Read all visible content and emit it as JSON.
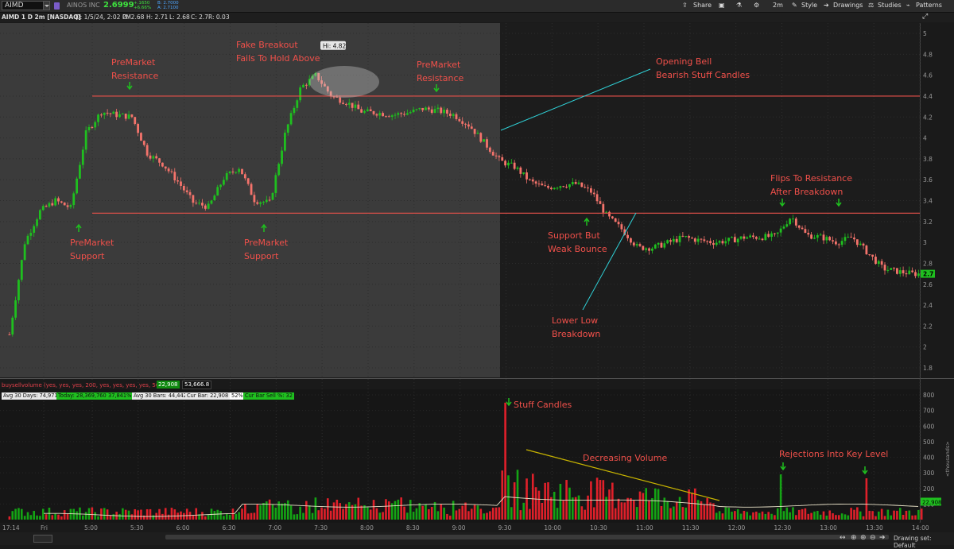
{
  "toolbar": {
    "symbol": "AIMD",
    "company": "AINOS INC",
    "last": "2.6999",
    "change_abs": "+.1650",
    "change_pct": "+6.66%",
    "bid": "B: 2.7000",
    "ask": "A: 2.7100",
    "share": "Share",
    "aggregation": "2m",
    "style": "Style",
    "drawings": "Drawings",
    "studies": "Studies",
    "patterns": "Patterns"
  },
  "infobar": {
    "title": "AIMD 1 D 2m [NASDAQ]",
    "date": "D: 1/5/24, 2:02 PM",
    "open": "O: 2.68",
    "high": "H: 2.71",
    "low": "L: 2.68",
    "close": "C: 2.7",
    "range": "R: 0.03"
  },
  "colors": {
    "up": "#1fbf1f",
    "down": "#f4736b",
    "down_dark": "#e0202a",
    "level": "#e8514a",
    "annot": "#f0504a",
    "bull_text": "#ff5a4f",
    "line": "#2fd0d6",
    "vol_ma": "#e9e2c8",
    "trend": "#c8b400"
  },
  "chart_data": [
    {
      "type": "line",
      "title": "AIMD 1 D 2m [NASDAQ]",
      "price_axis": {
        "ylim": [
          1.72,
          5.08
        ],
        "ticks": [
          "5",
          "4.8",
          "4.6",
          "4.4",
          "4.2",
          "4",
          "3.8",
          "3.6",
          "3.4",
          "3.2",
          "3",
          "2.8",
          "2.6",
          "2.4",
          "2.2",
          "2",
          "1.8"
        ]
      },
      "time_axis": {
        "ticks": [
          "17:14",
          "Fri",
          "5:00",
          "5:30",
          "6:00",
          "6:30",
          "7:00",
          "7:30",
          "8:00",
          "8:30",
          "9:00",
          "9:30",
          "10:00",
          "10:30",
          "11:00",
          "11:30",
          "12:00",
          "12:30",
          "13:00",
          "13:30",
          "14:00"
        ]
      },
      "series": [
        {
          "x": [
            "4:06",
            "4:16",
            "4:26",
            "4:36",
            "4:46",
            "4:56",
            "5:06",
            "5:16",
            "5:26",
            "5:36",
            "5:46",
            "5:56",
            "6:06",
            "6:16",
            "6:26",
            "6:36",
            "6:46",
            "6:56",
            "7:06",
            "7:16",
            "7:26",
            "7:36",
            "7:46",
            "7:56",
            "8:06",
            "8:16",
            "8:26",
            "8:36",
            "8:46",
            "8:56",
            "9:06",
            "9:16",
            "9:26",
            "9:36",
            "9:46",
            "9:56",
            "10:06",
            "10:16",
            "10:26",
            "10:36",
            "10:46",
            "10:56",
            "11:06",
            "11:16",
            "11:26",
            "11:36",
            "11:46",
            "11:56",
            "12:06",
            "12:16",
            "12:26",
            "12:36",
            "12:46",
            "12:56",
            "13:06",
            "13:16",
            "13:26",
            "13:36",
            "13:46",
            "13:56",
            "14:02"
          ],
          "close": [
            2.12,
            3.0,
            3.3,
            3.4,
            3.33,
            4.05,
            4.25,
            4.22,
            4.2,
            3.85,
            3.75,
            3.58,
            3.38,
            3.34,
            3.62,
            3.72,
            3.4,
            3.38,
            4.05,
            4.48,
            4.6,
            4.4,
            4.34,
            4.25,
            4.24,
            4.22,
            4.24,
            4.28,
            4.26,
            4.22,
            4.12,
            3.95,
            3.78,
            3.72,
            3.58,
            3.52,
            3.55,
            3.56,
            3.48,
            3.25,
            3.12,
            2.95,
            2.95,
            3.0,
            3.05,
            3.02,
            3.0,
            3.02,
            3.05,
            3.05,
            3.06,
            3.25,
            3.07,
            3.05,
            3.0,
            3.05,
            2.9,
            2.75,
            2.72,
            2.7,
            2.7
          ]
        }
      ],
      "last_price_label": "2.7",
      "hi_label": "Hi: 4.82",
      "levels": [
        {
          "price": 4.4,
          "name": "resistance"
        },
        {
          "price": 3.28,
          "name": "support"
        }
      ],
      "annotations": {
        "pm_resistance_1": [
          "PreMarket",
          "Resistance"
        ],
        "fake_breakout": [
          "Fake Breakout",
          "Fails To Hold Above"
        ],
        "pm_resistance_2": [
          "PreMarket",
          "Resistance"
        ],
        "opening_bell": [
          "Opening Bell",
          "Bearish Stuff Candles"
        ],
        "pm_support_1": [
          "PreMarket",
          "Support"
        ],
        "pm_support_2": [
          "PreMarket",
          "Support"
        ],
        "weak_bounce": [
          "Support But",
          "Weak Bounce"
        ],
        "lower_low": [
          "Lower Low",
          "Breakdown"
        ],
        "flips": [
          "Flips To Resistance",
          "After Breakdown"
        ]
      }
    },
    {
      "type": "bar",
      "title": "buysellvolume (yes, yes, yes, 200, yes, yes, yes, yes, 50)",
      "ylabel": "<thousands>",
      "ylim": [
        0,
        820
      ],
      "ticks": [
        "800",
        "700",
        "600",
        "500",
        "400",
        "300",
        "200",
        "100"
      ],
      "volume_peaks": [
        {
          "time": "9:30",
          "value": 750
        },
        {
          "time": "12:30",
          "value": 290
        },
        {
          "time": "13:25",
          "value": 265
        }
      ],
      "cur_label": "22,908",
      "header_values": [
        "22,908",
        "53,666.8"
      ],
      "annotations": {
        "stuff": "Stuff Candles",
        "decreasing": "Decreasing Volume",
        "rejections": "Rejections Into Key Level"
      }
    }
  ],
  "stats": {
    "avg30days": "Avg 30 Days: 74,971",
    "today": "Today: 28,369,760",
    "today_pct": "37,841%",
    "avg30bars": "Avg 30 Bars: 44,442",
    "curbar": "Cur Bar: 22,908",
    "curbar_pct": "52%",
    "sellpct": "Cur Bar Sell %: 32"
  },
  "footer": {
    "drawing_set": "Drawing set: Default"
  }
}
